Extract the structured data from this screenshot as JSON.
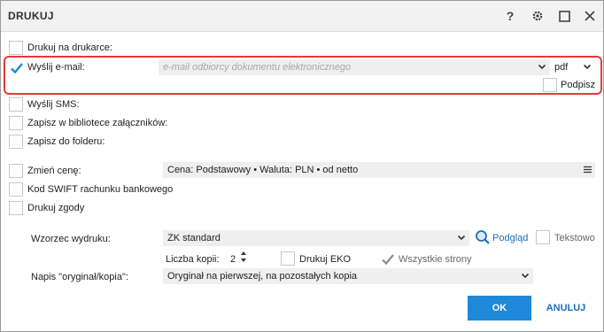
{
  "window": {
    "title": "DRUKUJ",
    "help_label": "?",
    "icons": [
      "gear-icon",
      "maximize-icon",
      "close-icon"
    ]
  },
  "options": {
    "print_on_printer": "Drukuj na drukarce:",
    "send_email": "Wyślij e-mail:",
    "email_placeholder": "e-mail odbiorcy dokumentu elektronicznego",
    "format": "pdf",
    "sign": "Podpisz",
    "send_sms": "Wyślij SMS:",
    "save_attachments": "Zapisz w bibliotece załączników:",
    "save_folder": "Zapisz do folderu:",
    "change_price": "Zmień cenę:",
    "price_value": "Cena: Podstawowy • Waluta: PLN • od netto",
    "swift": "Kod SWIFT rachunku bankowego",
    "print_consents": "Drukuj zgody"
  },
  "print": {
    "template_label": "Wzorzec wydruku:",
    "template_value": "ZK standard",
    "preview": "Podgląd",
    "text_mode": "Tekstowo",
    "copies_label": "Liczba kopii:",
    "copies_value": "2",
    "eco": "Drukuj EKO",
    "all_pages": "Wszystkie strony",
    "caption_label": "Napis \"oryginał/kopia\":",
    "caption_value": "Oryginał na pierwszej, na pozostałych kopia"
  },
  "buttons": {
    "ok": "OK",
    "cancel": "ANULUJ"
  },
  "colors": {
    "accent": "#1e88d9",
    "highlight_border": "#e23a3a",
    "field_bg": "#efefef",
    "check_blue": "#1e88d9"
  }
}
